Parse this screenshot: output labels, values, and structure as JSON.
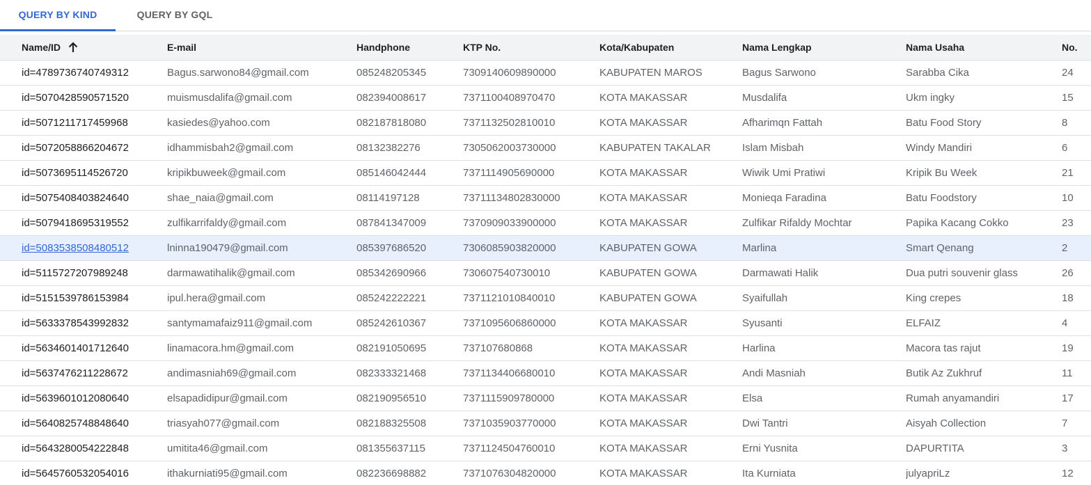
{
  "tabs": [
    {
      "label": "QUERY BY KIND",
      "active": true
    },
    {
      "label": "QUERY BY GQL",
      "active": false
    }
  ],
  "colors": {
    "accent": "#3367d6",
    "header_bg": "#f1f3f4",
    "selected_row": "#e8f0fe"
  },
  "table": {
    "sort_icon": "arrow-up-icon",
    "headers": [
      "Name/ID",
      "E-mail",
      "Handphone",
      "KTP No.",
      "Kota/Kabupaten",
      "Nama Lengkap",
      "Nama Usaha",
      "No."
    ],
    "rows": [
      [
        "id=4789736740749312",
        "Bagus.sarwono84@gmail.com",
        "085248205345",
        "7309140609890000",
        "KABUPATEN MAROS",
        "Bagus Sarwono",
        "Sarabba Cika",
        "24"
      ],
      [
        "id=5070428590571520",
        "muismusdalifa@gmail.com",
        "082394008617",
        "7371100408970470",
        "KOTA MAKASSAR",
        "Musdalifa",
        "Ukm ingky",
        "15"
      ],
      [
        "id=5071211717459968",
        "kasiedes@yahoo.com",
        "082187818080",
        "7371132502810010",
        "KOTA MAKASSAR",
        "Afharimqn Fattah",
        "Batu Food Story",
        "8"
      ],
      [
        "id=5072058866204672",
        "idhammisbah2@gmail.com",
        "08132382276",
        "7305062003730000",
        "KABUPATEN TAKALAR",
        "Islam Misbah",
        "Windy Mandiri",
        "6"
      ],
      [
        "id=5073695114526720",
        "kripikbuweek@gmail.com",
        "085146042444",
        "7371114905690000",
        "KOTA MAKASSAR",
        "Wiwik Umi Pratiwi",
        "Kripik Bu Week",
        "21"
      ],
      [
        "id=5075408403824640",
        "shae_naia@gmail.com",
        "08114197128",
        "73711134802830000",
        "KOTA MAKASSAR",
        "Monieqa Faradina",
        "Batu Foodstory",
        "10"
      ],
      [
        "id=5079418695319552",
        "zulfikarrifaldy@gmail.com",
        "087841347009",
        "7370909033900000",
        "KOTA MAKASSAR",
        "Zulfikar Rifaldy Mochtar",
        "Papika Kacang Cokko",
        "23"
      ],
      [
        "id=5083538508480512",
        "lninna190479@gmail.com",
        "085397686520",
        "7306085903820000",
        "KABUPATEN GOWA",
        "Marlina",
        "Smart Qenang",
        "2"
      ],
      [
        "id=5115727207989248",
        "darmawatihalik@gmail.com",
        "085342690966",
        "730607540730010",
        "KABUPATEN GOWA",
        "Darmawati Halik",
        "Dua putri souvenir glass",
        "26"
      ],
      [
        "id=5151539786153984",
        "ipul.hera@gmail.com",
        "085242222221",
        "7371121010840010",
        "KABUPATEN GOWA",
        "Syaifullah",
        "King crepes",
        "18"
      ],
      [
        "id=5633378543992832",
        "santymamafaiz911@gmail.com",
        "085242610367",
        "7371095606860000",
        "KOTA MAKASSAR",
        "Syusanti",
        "ELFAIZ",
        "4"
      ],
      [
        "id=5634601401712640",
        "linamacora.hm@gmail.com",
        "082191050695",
        "737107680868",
        "KOTA MAKASSAR",
        "Harlina",
        "Macora tas rajut",
        "19"
      ],
      [
        "id=5637476211228672",
        "andimasniah69@gmail.com",
        "082333321468",
        "7371134406680010",
        "KOTA MAKASSAR",
        "Andi Masniah",
        "Butik Az Zukhruf",
        "11"
      ],
      [
        "id=5639601012080640",
        "elsapadidipur@gmail.com",
        "082190956510",
        "7371115909780000",
        "KOTA MAKASSAR",
        "Elsa",
        "Rumah anyamandiri",
        "17"
      ],
      [
        "id=5640825748848640",
        "triasyah077@gmail.com",
        "082188325508",
        "7371035903770000",
        "KOTA MAKASSAR",
        "Dwi Tantri",
        "Aisyah Collection",
        "7"
      ],
      [
        "id=5643280054222848",
        "umitita46@gmail.com",
        "081355637115",
        "7371124504760010",
        "KOTA MAKASSAR",
        "Erni Yusnita",
        "DAPURTITA",
        "3"
      ],
      [
        "id=5645760532054016",
        "ithakurniati95@gmail.com",
        "082236698882",
        "7371076304820000",
        "KOTA MAKASSAR",
        "Ita Kurniata",
        "julyapriLz",
        "12"
      ]
    ],
    "selected_row": 7
  }
}
